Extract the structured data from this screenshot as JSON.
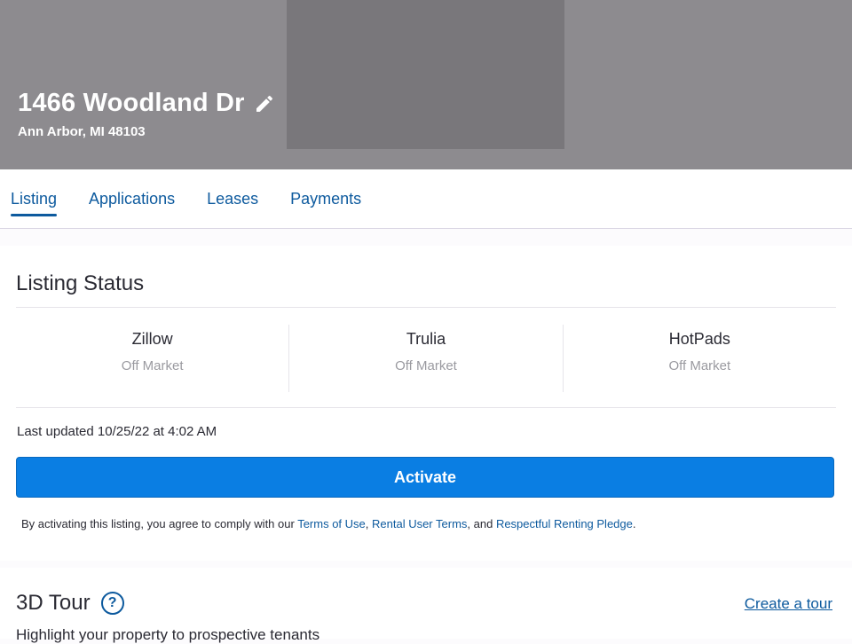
{
  "header": {
    "address": "1466 Woodland Dr",
    "city": "Ann Arbor, MI 48103",
    "edit_icon": "pencil-icon"
  },
  "tabs": [
    {
      "label": "Listing",
      "active": true
    },
    {
      "label": "Applications",
      "active": false
    },
    {
      "label": "Leases",
      "active": false
    },
    {
      "label": "Payments",
      "active": false
    }
  ],
  "listing_status": {
    "title": "Listing Status",
    "sites": [
      {
        "name": "Zillow",
        "status": "Off Market"
      },
      {
        "name": "Trulia",
        "status": "Off Market"
      },
      {
        "name": "HotPads",
        "status": "Off Market"
      }
    ],
    "last_updated": "Last updated 10/25/22 at 4:02 AM",
    "activate_label": "Activate",
    "agree": {
      "prefix": "By activating this listing, you agree to comply with our ",
      "terms_of_use": "Terms of Use",
      "sep1": ", ",
      "rental_user_terms": "Rental User Terms",
      "sep2": ", and ",
      "respectful_renting": "Respectful Renting Pledge",
      "suffix": "."
    }
  },
  "tour": {
    "title": "3D Tour",
    "help_glyph": "?",
    "create_label": "Create a tour",
    "subtitle": "Highlight your property to prospective tenants"
  },
  "colors": {
    "primary": "#0a7ee3",
    "link": "#0d5a9e",
    "muted": "#9a9aa0"
  }
}
